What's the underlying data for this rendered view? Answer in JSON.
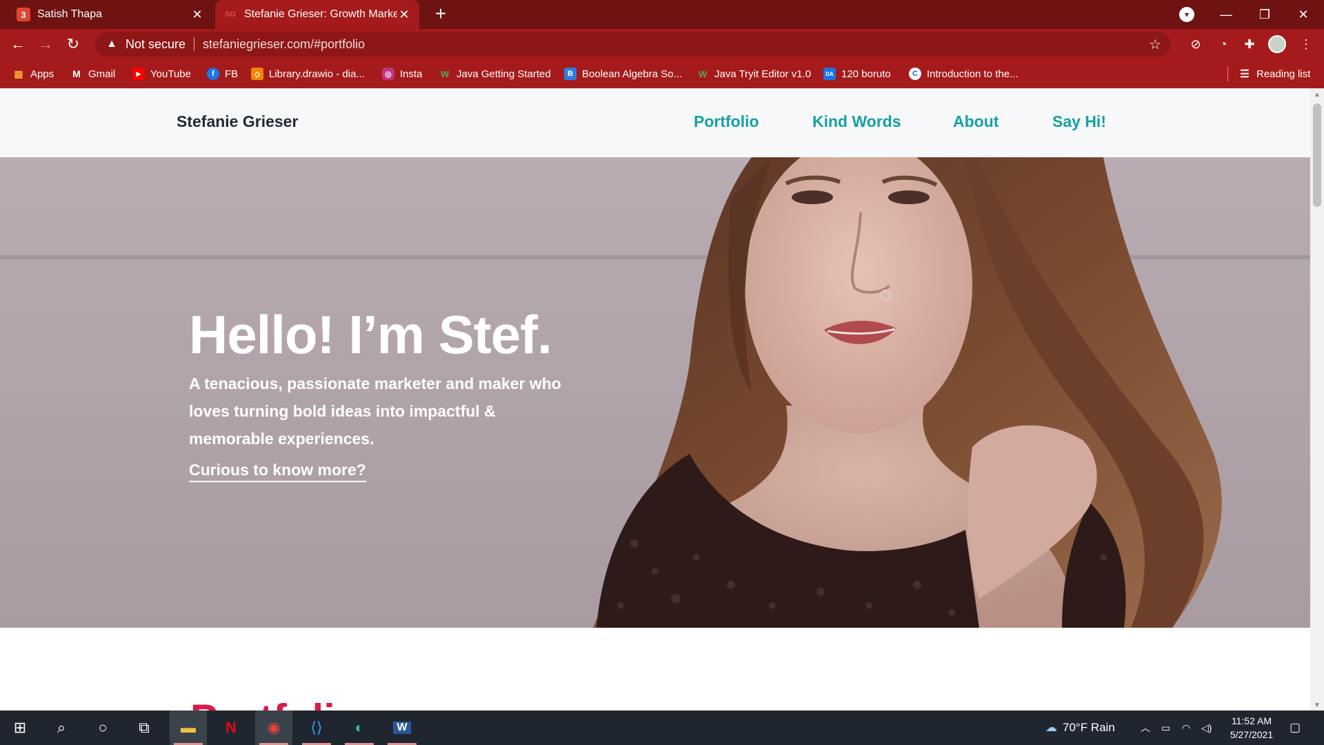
{
  "browser": {
    "tabs": [
      {
        "title": "Satish Thapa",
        "favicon": "3"
      },
      {
        "title": "Stefanie Grieser: Growth Markete",
        "favicon": "SG"
      }
    ],
    "security_label": "Not secure",
    "url": "stefaniegrieser.com/#portfolio",
    "bookmarks": [
      {
        "label": "Apps",
        "icon": "apps-grid-icon"
      },
      {
        "label": "Gmail",
        "icon": "gmail-icon"
      },
      {
        "label": "YouTube",
        "icon": "youtube-icon"
      },
      {
        "label": "FB",
        "icon": "facebook-icon"
      },
      {
        "label": "Library.drawio - dia...",
        "icon": "drawio-icon"
      },
      {
        "label": "Insta",
        "icon": "instagram-icon"
      },
      {
        "label": "Java Getting Started",
        "icon": "w-icon"
      },
      {
        "label": "Boolean Algebra So...",
        "icon": "b-icon"
      },
      {
        "label": "Java Tryit Editor v1.0",
        "icon": "w-icon"
      },
      {
        "label": "120 boruto",
        "icon": "da-icon",
        "glyph": "DA"
      },
      {
        "label": "Introduction to the...",
        "icon": "c-icon"
      }
    ],
    "reading_list": "Reading list",
    "colors": {
      "tabstrip": "#6e1212",
      "toolbar": "#a51a1a"
    }
  },
  "site": {
    "brand": "Stefanie Grieser",
    "nav": [
      "Portfolio",
      "Kind Words",
      "About",
      "Say Hi!"
    ],
    "hero": {
      "title": "Hello! I’m Stef.",
      "subtitle": "A tenacious, passionate marketer and maker who loves turning bold ideas into impactful & memorable experiences.",
      "link": "Curious to know more?"
    },
    "next_section_heading_partial": "Portfoli",
    "colors": {
      "nav_link": "#16a0a4",
      "heading_accent": "#d81b4a",
      "header_bg": "#f7f8f9"
    }
  },
  "taskbar": {
    "weather": "70°F  Rain",
    "time": "11:52 AM",
    "date": "5/27/2021"
  }
}
